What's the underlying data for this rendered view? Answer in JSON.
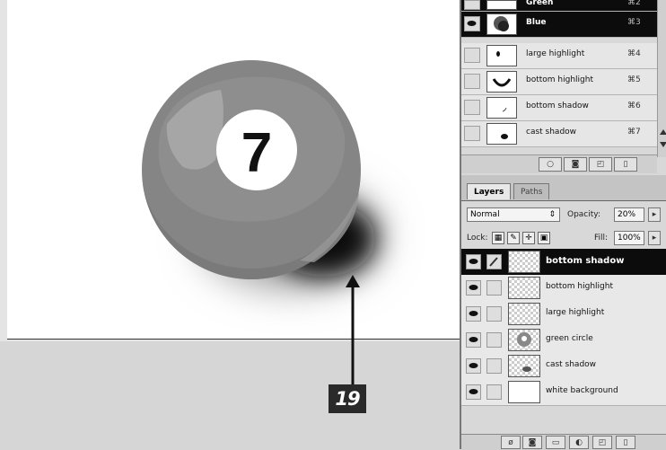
{
  "channels": {
    "rows": [
      {
        "name": "Green",
        "shortcut": "⌘2",
        "selected": true
      },
      {
        "name": "Blue",
        "shortcut": "⌘3",
        "selected": true
      },
      {
        "name": "large highlight",
        "shortcut": "⌘4",
        "selected": false
      },
      {
        "name": "bottom highlight",
        "shortcut": "⌘5",
        "selected": false
      },
      {
        "name": "bottom shadow",
        "shortcut": "⌘6",
        "selected": false
      },
      {
        "name": "cast shadow",
        "shortcut": "⌘7",
        "selected": false
      }
    ]
  },
  "layers": {
    "tabs": [
      "Layers",
      "Paths"
    ],
    "blend_mode": "Normal",
    "opacity_label": "Opacity:",
    "opacity_value": "20%",
    "lock_label": "Lock:",
    "fill_label": "Fill:",
    "fill_value": "100%",
    "rows": [
      {
        "name": "bottom shadow",
        "selected": true
      },
      {
        "name": "bottom highlight",
        "selected": false
      },
      {
        "name": "large highlight",
        "selected": false
      },
      {
        "name": "green circle",
        "selected": false
      },
      {
        "name": "cast shadow",
        "selected": false
      },
      {
        "name": "white background",
        "selected": false
      }
    ]
  },
  "canvas": {
    "ball_number": "7"
  },
  "callout": {
    "number": "19"
  },
  "colors": {
    "ball": "#858585",
    "highlight": "#a6a6a6",
    "shadow": "#111111",
    "selected_row": "#0c0c0c"
  }
}
